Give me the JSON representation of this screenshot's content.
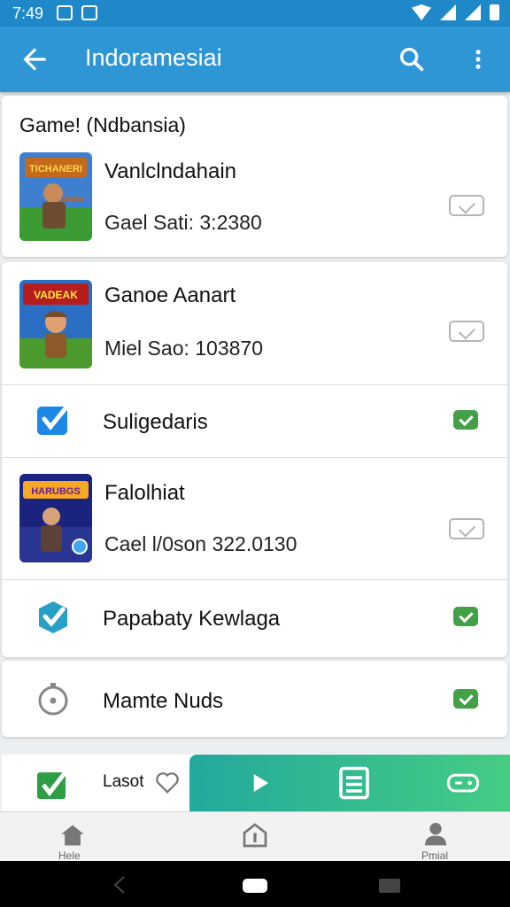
{
  "status_bar": {
    "time": "7:49"
  },
  "app_bar": {
    "title": "Indoramesiai",
    "back_icon": "arrow-left-icon",
    "search_icon": "search-icon",
    "more_icon": "more-vert-icon"
  },
  "colors": {
    "app_bar": "#2f96d6",
    "status_bar": "#1e88c8",
    "accent_green": "#43a047",
    "teal": "#23a99c"
  },
  "section": {
    "title": "Game! (Ndbansia)"
  },
  "items": [
    {
      "title": "Vanlclndahain",
      "subtitle": "Gael  Sati: 3:2380",
      "thumb_text": "TICHANERI",
      "checked": false
    },
    {
      "title": "Ganoe Aanart",
      "subtitle": "Miel  Sao: 103870",
      "thumb_text": "VADEAK",
      "checked": false
    },
    {
      "label": "Suligedaris",
      "checked": true
    },
    {
      "title": "Falolhiat",
      "subtitle": "Cael  l/0son 322.0130",
      "thumb_text": "HARUBGS",
      "checked": false
    },
    {
      "label": "Papabaty Kewlaga",
      "checked": true
    },
    {
      "label": "Mamte Nuds",
      "checked": true
    }
  ],
  "fab_bar": {
    "label": "Lasot",
    "icons": [
      "heart-icon",
      "play-icon",
      "list-icon",
      "gamepad-icon"
    ]
  },
  "bottom_nav": {
    "items": [
      {
        "label": "Hele",
        "icon": "home-icon"
      },
      {
        "label": "",
        "icon": "upload-icon"
      },
      {
        "label": "Pmial",
        "icon": "person-icon"
      }
    ]
  }
}
